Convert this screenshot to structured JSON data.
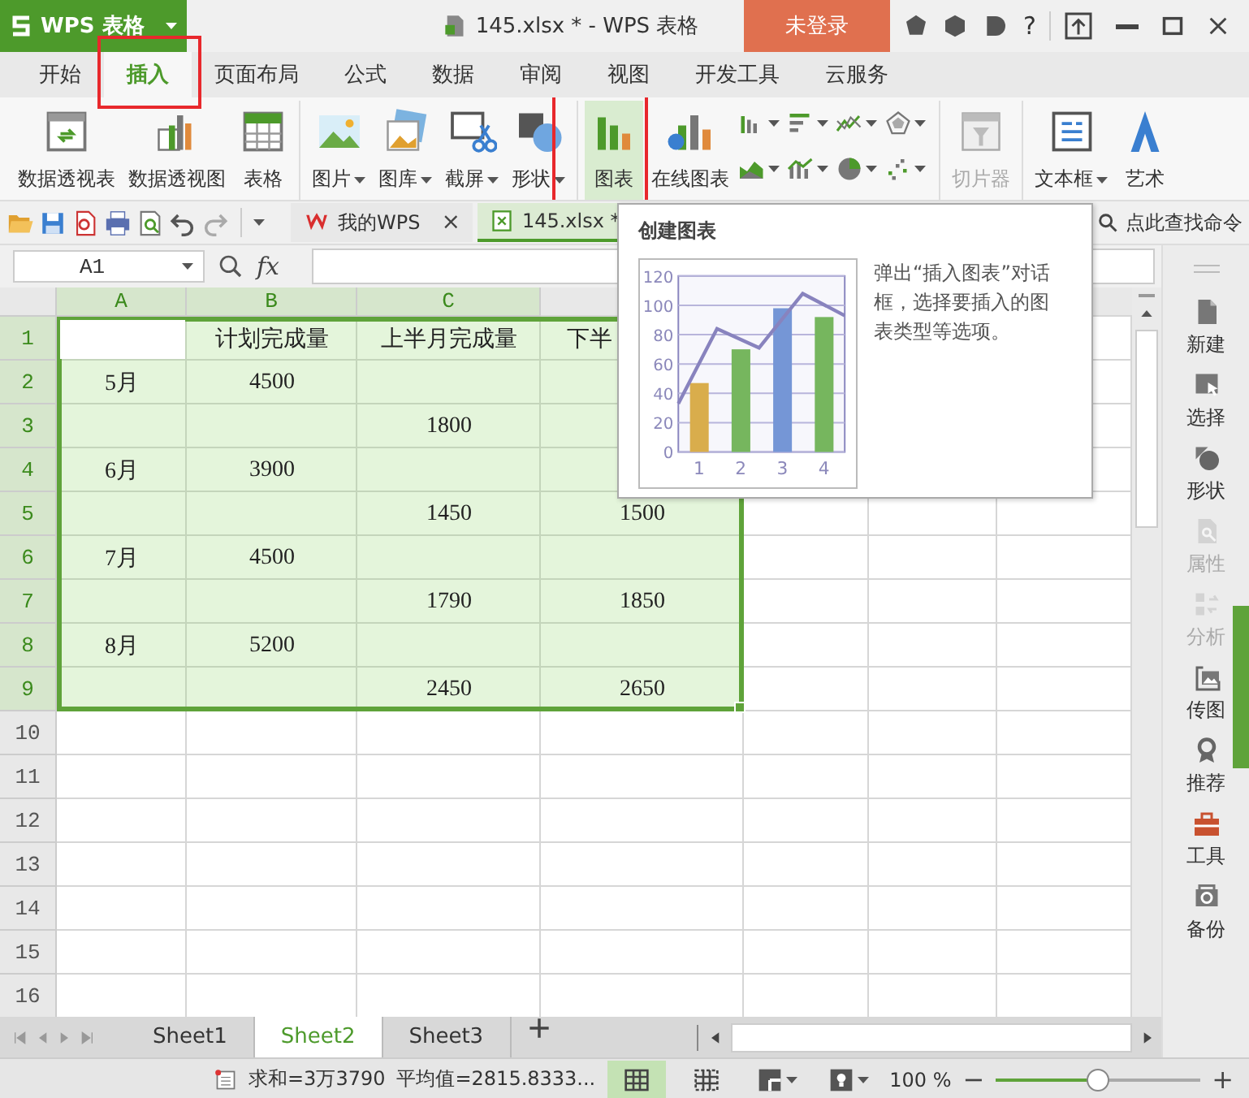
{
  "title_bar": {
    "app_menu": "WPS 表格",
    "title": "145.xlsx * - WPS 表格",
    "login_button": "未登录",
    "help_button": "?"
  },
  "ribbon_tabs": [
    {
      "label": "开始",
      "selected": false,
      "marked": false
    },
    {
      "label": "插入",
      "selected": true,
      "marked": true
    },
    {
      "label": "页面布局",
      "selected": false,
      "marked": false
    },
    {
      "label": "公式",
      "selected": false,
      "marked": false
    },
    {
      "label": "数据",
      "selected": false,
      "marked": false
    },
    {
      "label": "审阅",
      "selected": false,
      "marked": false
    },
    {
      "label": "视图",
      "selected": false,
      "marked": false
    },
    {
      "label": "开发工具",
      "selected": false,
      "marked": false
    },
    {
      "label": "云服务",
      "selected": false,
      "marked": false
    }
  ],
  "ribbon": {
    "groups": [
      {
        "items": [
          {
            "label": "数据透视表",
            "dropdown": false,
            "selected": false,
            "disabled": false,
            "marked": false
          },
          {
            "label": "数据透视图",
            "dropdown": false,
            "selected": false,
            "disabled": false,
            "marked": false
          },
          {
            "label": "表格",
            "dropdown": false,
            "selected": false,
            "disabled": false,
            "marked": false
          }
        ]
      },
      {
        "items": [
          {
            "label": "图片",
            "dropdown": true,
            "selected": false,
            "disabled": false,
            "marked": false
          },
          {
            "label": "图库",
            "dropdown": true,
            "selected": false,
            "disabled": false,
            "marked": false
          },
          {
            "label": "截屏",
            "dropdown": true,
            "selected": false,
            "disabled": false,
            "marked": false
          },
          {
            "label": "形状",
            "dropdown": true,
            "selected": false,
            "disabled": false,
            "marked": false
          }
        ]
      },
      {
        "items": [
          {
            "label": "图表",
            "dropdown": false,
            "selected": true,
            "disabled": false,
            "marked": true
          },
          {
            "label": "在线图表",
            "dropdown": false,
            "selected": false,
            "disabled": false,
            "marked": false
          }
        ],
        "small_buttons": [
          {
            "dropdown": true
          },
          {
            "dropdown": true
          },
          {
            "dropdown": true
          },
          {
            "dropdown": true
          },
          {
            "dropdown": true
          },
          {
            "dropdown": true
          },
          {
            "dropdown": true
          },
          {
            "dropdown": true
          }
        ]
      },
      {
        "items": [
          {
            "label": "切片器",
            "dropdown": false,
            "selected": false,
            "disabled": true,
            "marked": false
          }
        ]
      },
      {
        "items": [
          {
            "label": "文本框",
            "dropdown": true,
            "selected": false,
            "disabled": false,
            "marked": false
          },
          {
            "label": "艺术",
            "dropdown": false,
            "selected": false,
            "disabled": false,
            "marked": false
          }
        ]
      }
    ]
  },
  "doc_tabs": [
    {
      "label": "我的WPS",
      "selected": false,
      "close": "×"
    },
    {
      "label": "145.xlsx *",
      "selected": true
    }
  ],
  "command_search": {
    "placeholder": "点此查找命令"
  },
  "formula_bar": {
    "name_box": "A1",
    "function_label": "fx"
  },
  "sheet": {
    "columns": [
      {
        "label": "A",
        "selected": true
      },
      {
        "label": "B",
        "selected": true
      },
      {
        "label": "C",
        "selected": true
      }
    ],
    "rows": [
      {
        "header": "1",
        "selected": true,
        "cells": [
          {
            "active": true
          },
          "计划完成量",
          "上半月完成量",
          "下半"
        ]
      },
      {
        "header": "2",
        "selected": true,
        "cells": [
          "5月",
          "4500",
          null,
          null
        ]
      },
      {
        "header": "3",
        "selected": true,
        "cells": [
          null,
          null,
          "1800",
          null
        ]
      },
      {
        "header": "4",
        "selected": true,
        "cells": [
          "6月",
          "3900",
          null,
          null
        ]
      },
      {
        "header": "5",
        "selected": true,
        "cells": [
          null,
          null,
          "1450",
          "1500"
        ]
      },
      {
        "header": "6",
        "selected": true,
        "cells": [
          "7月",
          "4500",
          null,
          null
        ]
      },
      {
        "header": "7",
        "selected": true,
        "cells": [
          null,
          null,
          "1790",
          "1850"
        ]
      },
      {
        "header": "8",
        "selected": true,
        "cells": [
          "8月",
          "5200",
          null,
          null
        ]
      },
      {
        "header": "9",
        "selected": true,
        "cells": [
          null,
          null,
          "2450",
          "2650"
        ]
      },
      {
        "header": "10",
        "selected": false,
        "cells": []
      },
      {
        "header": "11",
        "selected": false,
        "cells": []
      },
      {
        "header": "12",
        "selected": false,
        "cells": []
      },
      {
        "header": "13",
        "selected": false,
        "cells": []
      },
      {
        "header": "14",
        "selected": false,
        "cells": []
      },
      {
        "header": "15",
        "selected": false,
        "cells": []
      },
      {
        "header": "16",
        "selected": false,
        "cells": []
      }
    ]
  },
  "tooltip": {
    "title": "创建图表",
    "description": "弹出“插入图表”对话框，选择要插入的图表类型等选项。",
    "chart_data": {
      "type": "bar",
      "grid": true,
      "x": [
        1,
        2,
        3,
        4
      ],
      "xlim": [
        0.5,
        4.5
      ],
      "xticks": [
        1,
        2,
        3,
        4
      ],
      "ylim": [
        0,
        120
      ],
      "yticks": [
        0,
        20,
        40,
        60,
        80,
        100,
        120
      ],
      "series": [
        {
          "values": [
            47,
            70,
            98,
            92
          ],
          "colors": [
            "#d9ad4c",
            "#76b65e",
            "#7596d6",
            "#76b65e"
          ]
        },
        {
          "type": "line",
          "color": "#8883be",
          "x": [
            0.5,
            1.43,
            2.44,
            3.49,
            4.5
          ],
          "values": [
            33,
            84,
            71,
            108,
            93
          ]
        }
      ]
    }
  },
  "side_panel": [
    {
      "label": "新建",
      "disabled": false
    },
    {
      "label": "选择",
      "disabled": false
    },
    {
      "label": "形状",
      "disabled": false
    },
    {
      "label": "属性",
      "disabled": true
    },
    {
      "label": "分析",
      "disabled": true
    },
    {
      "label": "传图",
      "disabled": false
    },
    {
      "label": "推荐",
      "disabled": false
    },
    {
      "label": "工具",
      "disabled": false
    },
    {
      "label": "备份",
      "disabled": false
    }
  ],
  "sheet_tabs": [
    {
      "label": "Sheet1",
      "selected": false
    },
    {
      "label": "Sheet2",
      "selected": true
    },
    {
      "label": "Sheet3",
      "selected": false
    }
  ],
  "status_bar": {
    "sum": "求和=3万3790",
    "average": "平均值=2815.8333...",
    "views": [
      {
        "selected": true
      },
      {
        "selected": false
      }
    ],
    "zoom": "100 %",
    "zoom_out": "−",
    "zoom_slider": {
      "level": 0.5
    },
    "zoom_in": "+"
  }
}
